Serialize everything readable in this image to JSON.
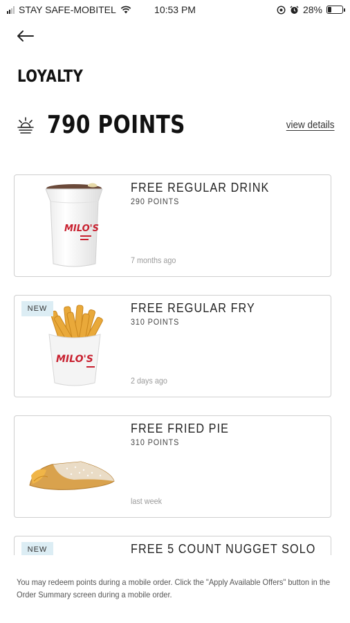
{
  "status_bar": {
    "carrier": "STAY SAFE-MOBITEL",
    "time": "10:53 PM",
    "battery_percent": "28%",
    "battery_level": 0.28,
    "icons": [
      "signal-icon",
      "wifi-icon",
      "location-icon",
      "alarm-icon",
      "battery-icon"
    ]
  },
  "header": {
    "back_icon": "arrow-left-icon",
    "title": "LOYALTY"
  },
  "points": {
    "icon": "sunrise-icon",
    "value": "790 POINTS",
    "view_details_label": "view details"
  },
  "rewards": [
    {
      "name": "FREE REGULAR DRINK",
      "points": "290 POINTS",
      "time": "7 months ago",
      "badge": "",
      "image": "milos-drink-cup"
    },
    {
      "name": "FREE REGULAR FRY",
      "points": "310 POINTS",
      "time": "2 days ago",
      "badge": "NEW",
      "image": "milos-fries"
    },
    {
      "name": "FREE FRIED PIE",
      "points": "310 POINTS",
      "time": "last week",
      "badge": "",
      "image": "fried-pie"
    },
    {
      "name": "FREE 5 COUNT NUGGET SOLO",
      "points": "",
      "time": "",
      "badge": "NEW",
      "image": ""
    }
  ],
  "footer": {
    "note": "You may redeem points during a mobile order. Click the \"Apply Available Offers\" button in the Order Summary screen during a mobile order."
  },
  "colors": {
    "badge_bg": "#dcedf4",
    "card_border": "#cfcfcf",
    "brand_red": "#c8202f"
  }
}
